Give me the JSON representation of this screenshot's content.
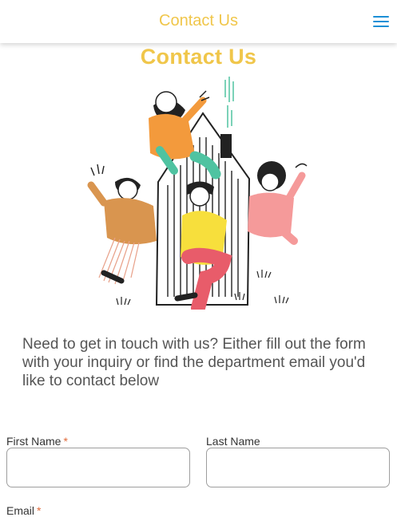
{
  "topbar": {
    "title": "Contact Us",
    "menu_icon": "hamburger-menu-icon",
    "title_color": "#f0c64a",
    "menu_color": "#1b8fd6"
  },
  "page": {
    "heading": "Contact Us",
    "intro_text": "Need to get in touch with us? Either fill out the form with your inquiry or find the department email you'd like to contact below"
  },
  "illustration": {
    "icon": "people-around-house-illustration"
  },
  "form": {
    "first_name": {
      "label": "First Name",
      "required_mark": "*",
      "value": "",
      "placeholder": ""
    },
    "last_name": {
      "label": "Last Name",
      "value": "",
      "placeholder": ""
    },
    "email": {
      "label": "Email",
      "required_mark": "*"
    }
  }
}
